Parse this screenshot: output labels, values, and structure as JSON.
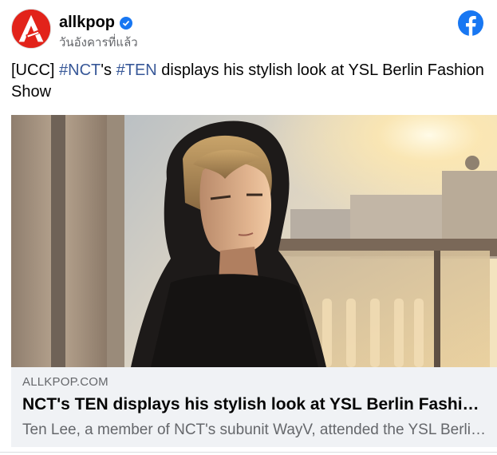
{
  "post": {
    "page_name": "allkpop",
    "timestamp": "วันอังคารที่แล้ว",
    "caption": {
      "prefix": "[UCC] ",
      "hashtag1": "#NCT",
      "mid": "'s ",
      "hashtag2": "#TEN",
      "suffix": " displays his stylish look at YSL Berlin Fashion Show"
    },
    "icons": {
      "avatar": "allkpop-logo",
      "verified": "verified-badge-icon",
      "platform": "facebook-icon"
    },
    "colors": {
      "link_blue": "#385898",
      "facebook_blue": "#1877f2",
      "brand_red": "#e2231a"
    }
  },
  "link_card": {
    "domain": "ALLKPOP.COM",
    "title": "NCT's TEN displays his stylish look at YSL Berlin Fashion Show",
    "description": "Ten Lee, a member of NCT's subunit WayV, attended the YSL Berlin Fashion Show"
  }
}
